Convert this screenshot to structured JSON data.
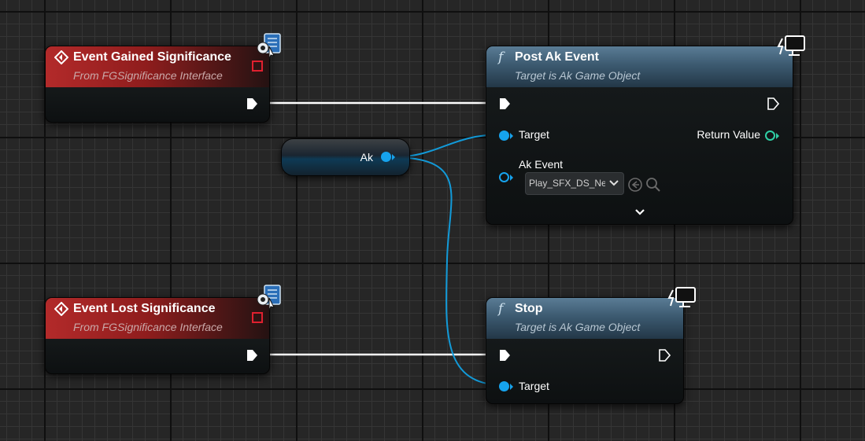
{
  "graph": {
    "event_gained": {
      "title": "Event Gained Significance",
      "subtitle": "From FGSignificance Interface",
      "icon": "event-diamond-icon",
      "corner_icon": "interface-function-icon"
    },
    "event_lost": {
      "title": "Event Lost Significance",
      "subtitle": "From FGSignificance Interface",
      "icon": "event-diamond-icon",
      "corner_icon": "interface-function-icon"
    },
    "post_ak_event": {
      "glyph": "f",
      "title": "Post Ak Event",
      "subtitle": "Target is Ak Game Object",
      "pin_target": "Target",
      "pin_return": "Return Value",
      "pin_ak_event": "Ak Event",
      "ak_event_value": "Play_SFX_DS_Ne",
      "corner_icon": "client-only-monitor-icon",
      "expand_icon": "chevron-down-icon"
    },
    "stop": {
      "glyph": "f",
      "title": "Stop",
      "subtitle": "Target is Ak Game Object",
      "pin_target": "Target",
      "corner_icon": "client-only-monitor-icon"
    },
    "variable": {
      "label": "Ak"
    },
    "colors": {
      "event_header": "#8f1d1d",
      "function_header": "#3c5a70",
      "object_pin": "#16a3ee",
      "return_pin": "#2fd0a6",
      "exec_wire": "#ffffff",
      "object_wire": "#129ad8"
    }
  }
}
